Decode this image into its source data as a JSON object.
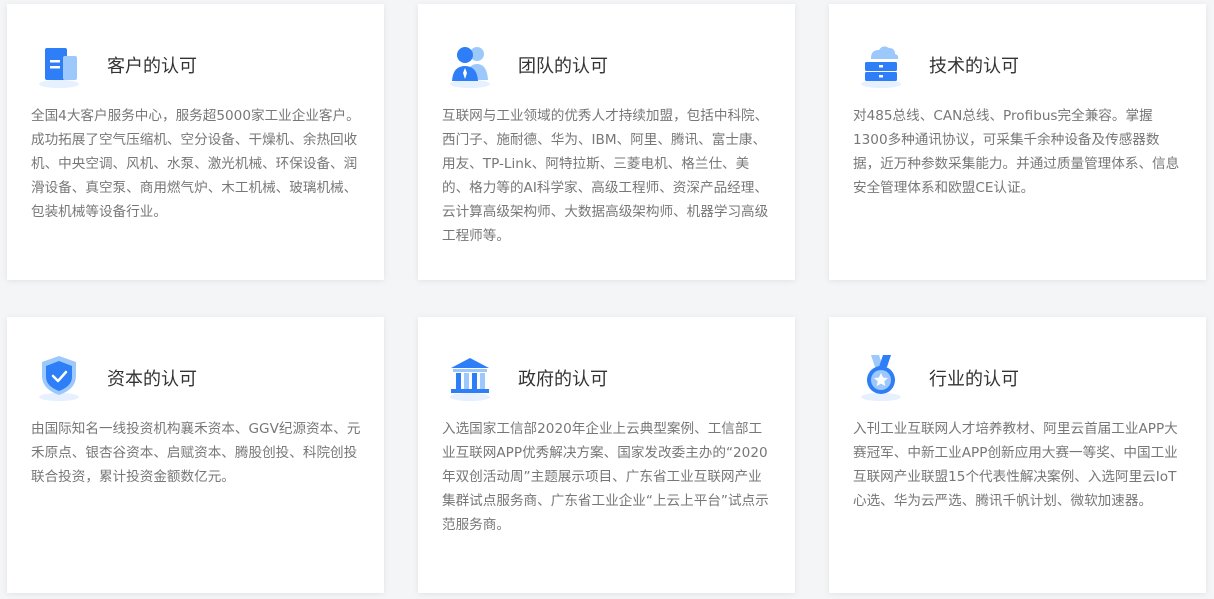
{
  "colors": {
    "page_bg": "#f4f5f7",
    "card_bg": "#ffffff",
    "title": "#333333",
    "text": "#777777",
    "icon_blue": "#2d7ef7",
    "icon_light": "#9cc8fb"
  },
  "cards": [
    {
      "icon": "building-icon",
      "title": "客户的认可",
      "text": "全国4大客户服务中心，服务超5000家工业企业客户。成功拓展了空气压缩机、空分设备、干燥机、余热回收机、中央空调、风机、水泵、激光机械、环保设备、润滑设备、真空泵、商用燃气炉、木工机械、玻璃机械、包装机械等设备行业。"
    },
    {
      "icon": "team-icon",
      "title": "团队的认可",
      "text": "互联网与工业领域的优秀人才持续加盟，包括中科院、西门子、施耐德、华为、IBM、阿里、腾讯、富士康、用友、TP-Link、阿特拉斯、三菱电机、格兰仕、美的、格力等的AI科学家、高级工程师、资深产品经理、云计算高级架构师、大数据高级架构师、机器学习高级工程师等。"
    },
    {
      "icon": "cloud-server-icon",
      "title": "技术的认可",
      "text": "对485总线、CAN总线、Profibus完全兼容。掌握1300多种通讯协议，可采集千余种设备及传感器数据，近万种参数采集能力。并通过质量管理体系、信息安全管理体系和欧盟CE认证。"
    },
    {
      "icon": "shield-check-icon",
      "title": "资本的认可",
      "text": "由国际知名一线投资机构襄禾资本、GGV纪源资本、元禾原点、银杏谷资本、启赋资本、腾股创投、科院创投联合投资，累计投资金额数亿元。"
    },
    {
      "icon": "government-building-icon",
      "title": "政府的认可",
      "text": "入选国家工信部2020年企业上云典型案例、工信部工业互联网APP优秀解决方案、国家发改委主办的“2020年双创活动周”主题展示项目、广东省工业互联网产业集群试点服务商、广东省工业企业“上云上平台”试点示范服务商。"
    },
    {
      "icon": "medal-icon",
      "title": "行业的认可",
      "text": "入刊工业互联网人才培养教材、阿里云首届工业APP大赛冠军、中新工业APP创新应用大赛一等奖、中国工业互联网产业联盟15个代表性解决案例、入选阿里云IoT心选、华为云严选、腾讯千帆计划、微软加速器。"
    }
  ]
}
